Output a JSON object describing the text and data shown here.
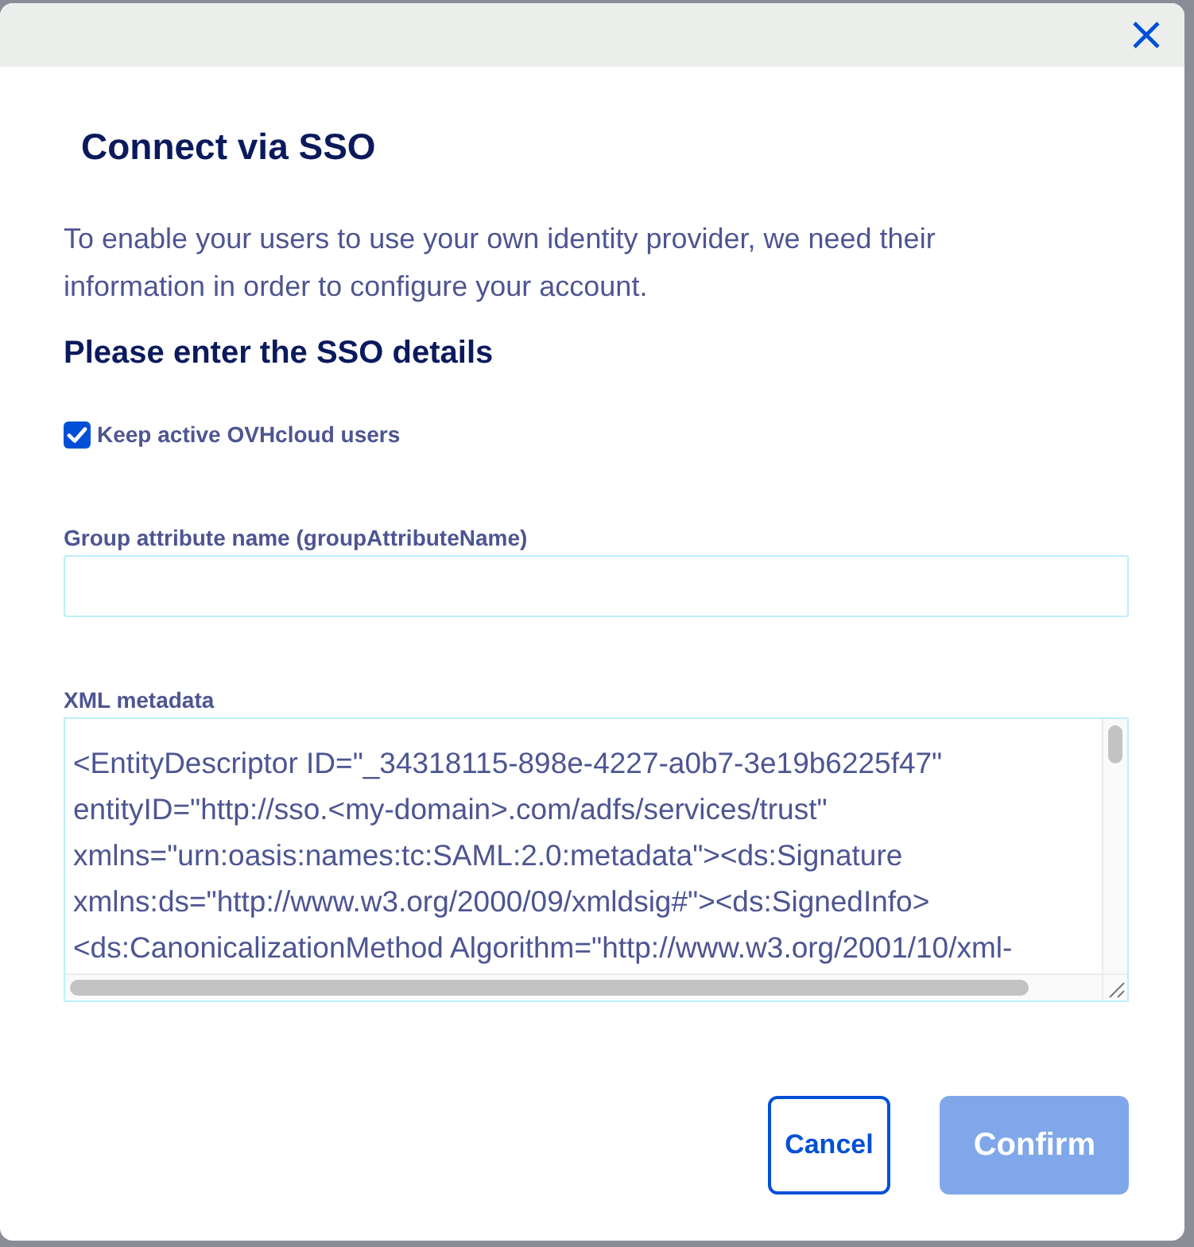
{
  "dialog": {
    "title": "Connect via SSO",
    "description": "To enable your users to use your own identity provider, we need their information in order to configure your account.",
    "section_title": "Please enter the SSO details",
    "keep_active": {
      "label": "Keep active OVHcloud users",
      "checked": true
    },
    "fields": [
      {
        "kind": "input",
        "label": "Group attribute name (groupAttributeName)"
      },
      {
        "kind": "textarea",
        "label": "XML metadata",
        "value_lines": [
          "<EntityDescriptor ID=\"_34318115-898e-4227-a0b7-3e19b6225f47\"",
          "entityID=\"http://sso.<my-domain>.com/adfs/services/trust\"",
          "xmlns=\"urn:oasis:names:tc:SAML:2.0:metadata\"><ds:Signature",
          "xmlns:ds=\"http://www.w3.org/2000/09/xmldsig#\"><ds:SignedInfo>",
          "<ds:CanonicalizationMethod Algorithm=\"http://www.w3.org/2001/10/xml-"
        ]
      }
    ],
    "buttons": [
      {
        "label": "Cancel",
        "kind": "secondary",
        "disabled": false
      },
      {
        "label": "Confirm",
        "kind": "primary",
        "disabled": true
      }
    ]
  }
}
